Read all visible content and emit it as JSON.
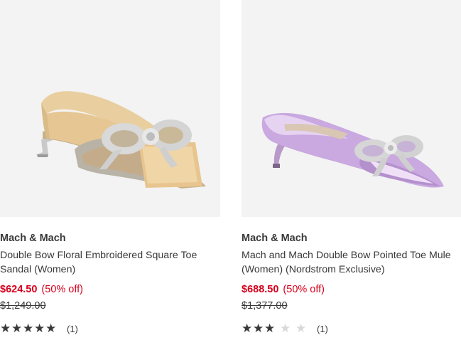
{
  "products": [
    {
      "brand": "Mach & Mach",
      "title": "Double Bow Floral Embroidered Square Toe Sandal (Women)",
      "sale_price": "$624.50",
      "discount": "(50% off)",
      "original_price": "$1,249.00",
      "rating": 5,
      "max_rating": 5,
      "review_count": "(1)",
      "image_alt": "gold satin mule sandal with crystal double bow"
    },
    {
      "brand": "Mach & Mach",
      "title": "Mach and Mach Double Bow Pointed Toe Mule (Women) (Nordstrom Exclusive)",
      "sale_price": "$688.50",
      "discount": "(50% off)",
      "original_price": "$1,377.00",
      "rating": 3,
      "max_rating": 5,
      "review_count": "(1)",
      "image_alt": "metallic lilac pointed toe mule with crystal double bow"
    }
  ],
  "colors": {
    "sale": "#d6001c",
    "text": "#393939",
    "image_bg": "#f3f3f3",
    "star_off": "#d9d9d9"
  }
}
